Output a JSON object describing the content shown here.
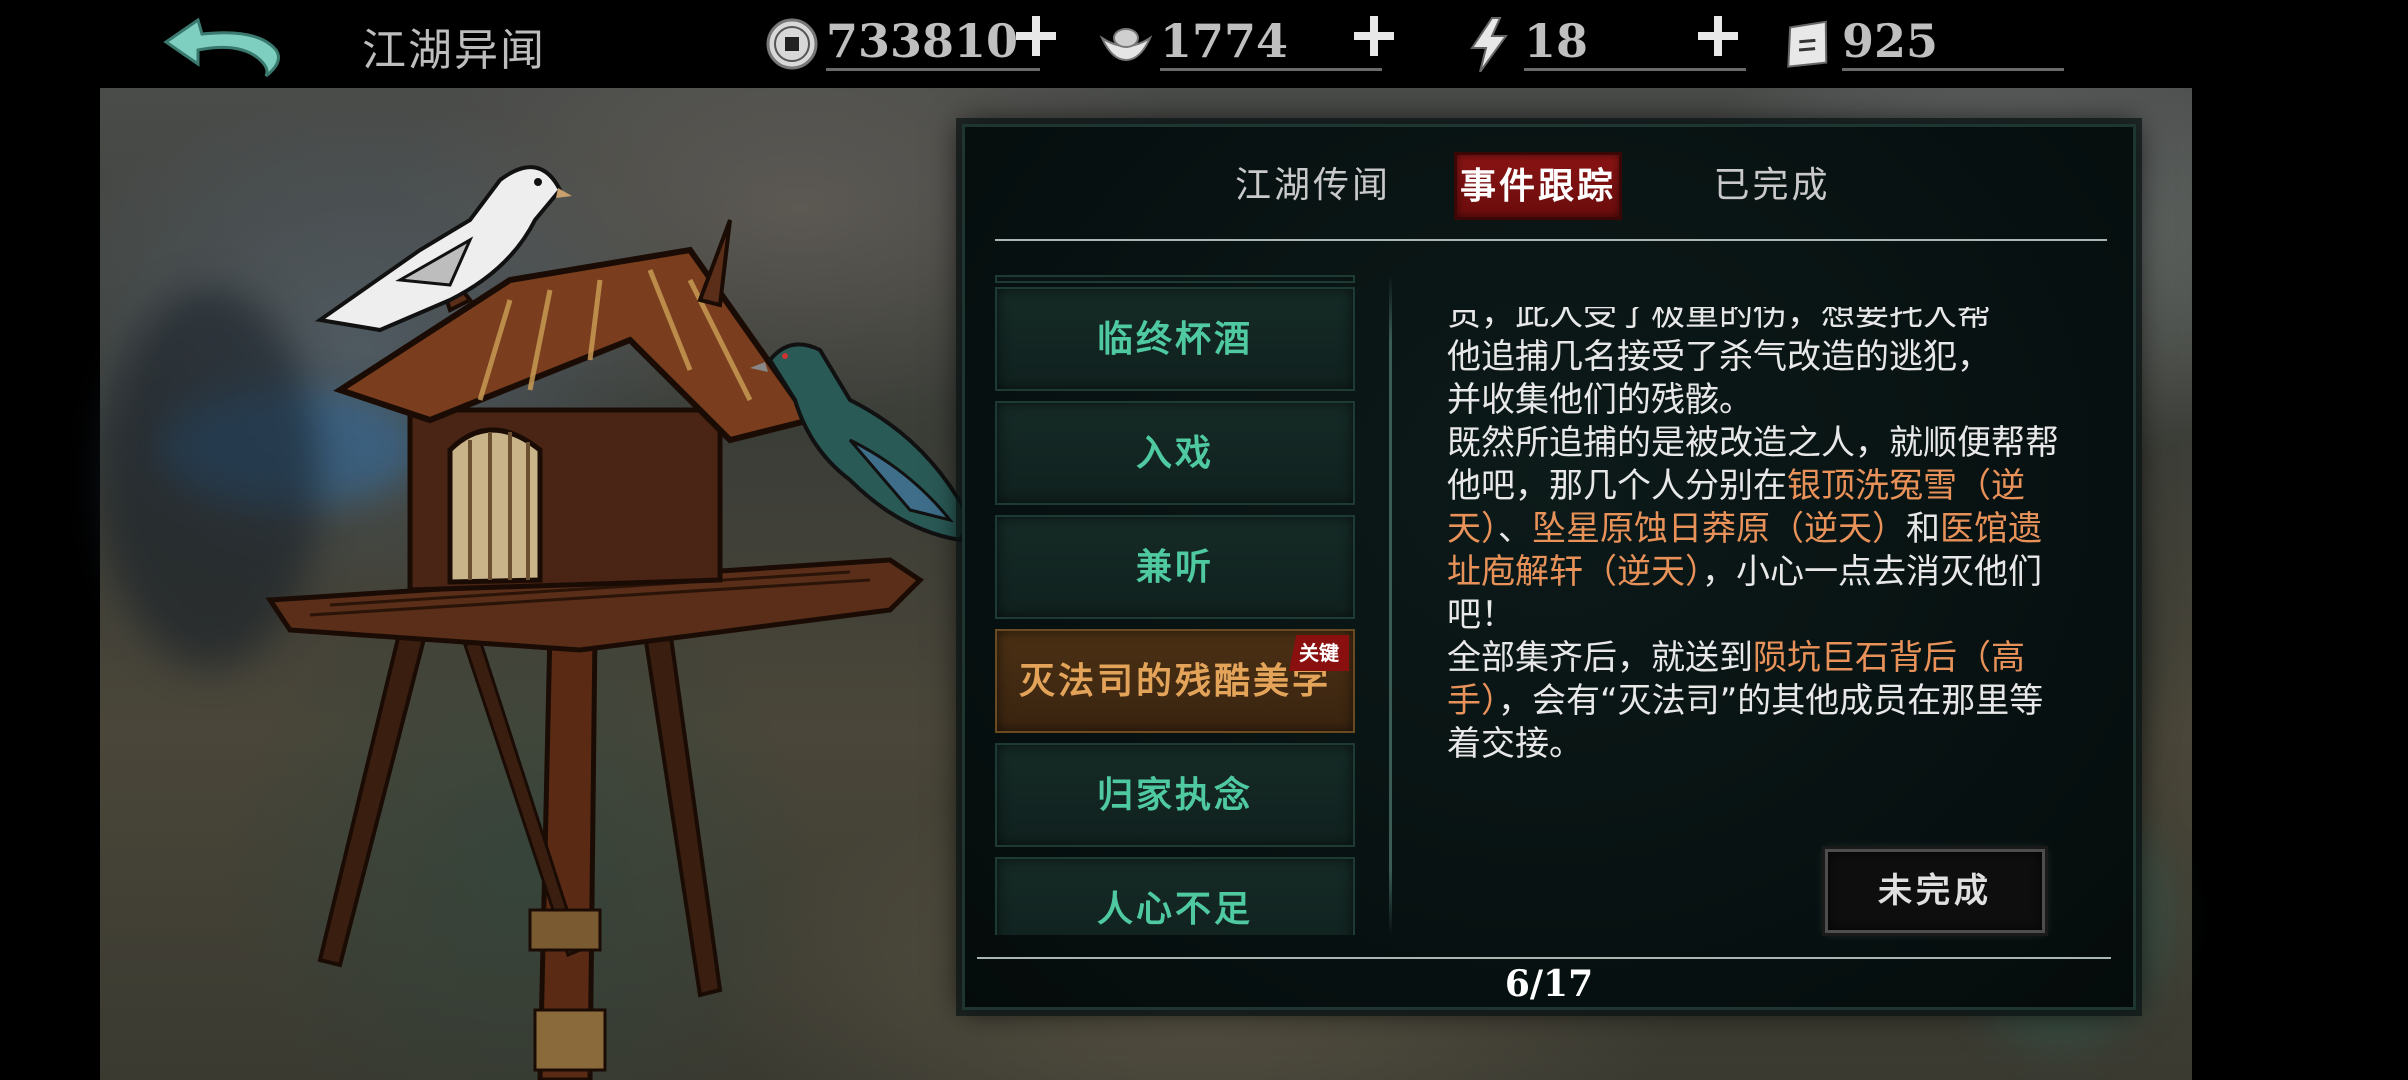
{
  "header": {
    "title": "江湖异闻",
    "resources": [
      {
        "icon": "copper-coin-icon",
        "value": "733810"
      },
      {
        "icon": "silver-ingot-icon",
        "value": "1774"
      },
      {
        "icon": "lightning-stamina-icon",
        "value": "18"
      },
      {
        "icon": "ticket-scroll-icon",
        "value": "925"
      }
    ]
  },
  "tabs": [
    {
      "label": "江湖传闻",
      "active": false
    },
    {
      "label": "事件跟踪",
      "active": true
    },
    {
      "label": "已完成",
      "active": false
    }
  ],
  "quests": [
    {
      "label": "临终杯酒",
      "selected": false
    },
    {
      "label": "入戏",
      "selected": false
    },
    {
      "label": "兼听",
      "selected": false
    },
    {
      "label": "灭法司的残酷美学",
      "selected": true,
      "badge": "关键"
    },
    {
      "label": "归家执念",
      "selected": false
    },
    {
      "label": "人心不足",
      "selected": false
    }
  ],
  "description": {
    "line0": "贡，此人受了极重的伤，想要托人帮",
    "line1": "他追捕几名接受了杀气改造的逃犯，",
    "line2": "并收集他们的残骸。",
    "p2_a": "既然所追捕的是被改造之人，就顺便帮帮他吧，那几个人分别在",
    "p2_loc1": "银顶洗冤雪（逆天）",
    "p2_b": "、",
    "p2_loc2": "坠星原蚀日莽原（逆天）",
    "p2_c": "和",
    "p2_loc3": "医馆遗址庖解轩（逆天）",
    "p2_d": "，小心一点去消灭他们吧！",
    "p3_a": "全部集齐后，就送到",
    "p3_loc": "陨坑巨石背后（高手）",
    "p3_b": "，会有“灭法司”的其他成员在那里等着交接。"
  },
  "status_button": "未完成",
  "pagination": "6/17",
  "colors": {
    "accent_green": "#4fc9a0",
    "highlight_orange": "#e8925a",
    "active_tab_red": "#8a1414",
    "selected_item_gold": "#e3a45a"
  }
}
